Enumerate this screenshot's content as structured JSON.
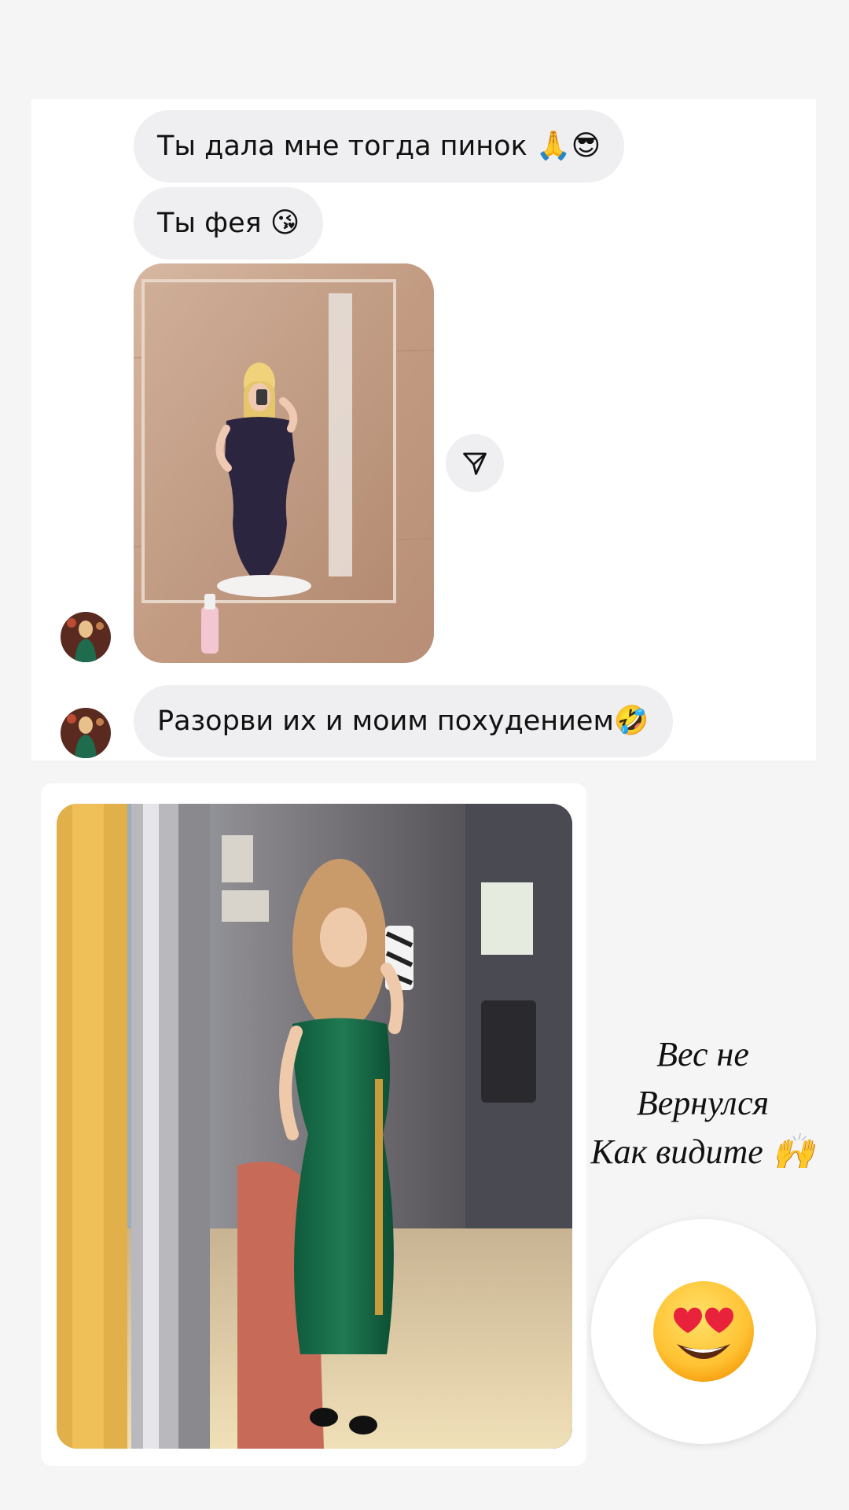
{
  "messages": [
    {
      "text": "Ты дала мне тогда пинок ",
      "emoji": "🙏😎"
    },
    {
      "text": "Ты фея ",
      "emoji": "😘"
    },
    {
      "text": "Разорви их и моим похудением",
      "emoji": "🤣"
    }
  ],
  "icons": {
    "share": "paper-plane-icon",
    "reaction": "heart-eyes-emoji"
  },
  "caption": {
    "line1": "Вес не",
    "line2": "Вернулся",
    "line3": "Как видите ",
    "line3_emoji": "🙌"
  },
  "sticker_emoji": "😍",
  "colors": {
    "background": "#f5f5f6",
    "chat_panel": "#ffffff",
    "bubble": "#efeff1",
    "text": "#111111"
  }
}
